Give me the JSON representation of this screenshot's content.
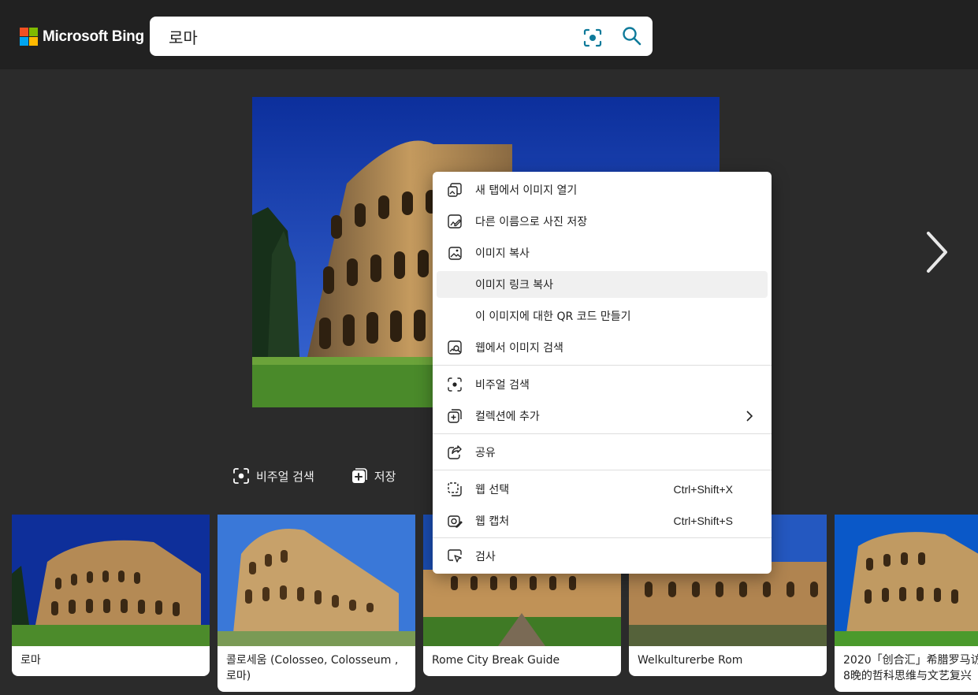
{
  "brand": {
    "name": "Microsoft Bing",
    "colors": [
      "#f25022",
      "#7fba00",
      "#00a4ef",
      "#ffb900"
    ]
  },
  "search": {
    "value": "로마",
    "visual_search_icon": "visual-search-icon",
    "search_icon": "magnifier-icon",
    "accent": "#0e7a9a"
  },
  "viewer": {
    "actions": [
      {
        "label": "비주얼 검색",
        "icon": "visual-search-icon"
      },
      {
        "label": "저장",
        "icon": "add-collection-icon"
      }
    ],
    "next_icon": "chevron-right-icon"
  },
  "context_menu": {
    "items": [
      {
        "label": "새 탭에서 이미지 열기",
        "icon": "open-image-new-tab-icon"
      },
      {
        "label": "다른 이름으로 사진 저장",
        "icon": "save-image-as-icon"
      },
      {
        "label": "이미지 복사",
        "icon": "copy-image-icon"
      },
      {
        "label": "이미지 링크 복사",
        "icon": ""
      },
      {
        "label": "이 이미지에 대한 QR 코드 만들기",
        "icon": ""
      },
      {
        "label": "웹에서 이미지 검색",
        "icon": "search-image-web-icon"
      },
      {
        "label": "비주얼 검색",
        "icon": "visual-search-icon"
      },
      {
        "label": "컬렉션에 추가",
        "icon": "add-to-collections-icon",
        "submenu": true
      },
      {
        "label": "공유",
        "icon": "share-icon"
      },
      {
        "label": "웹 선택",
        "icon": "web-select-icon",
        "shortcut": "Ctrl+Shift+X"
      },
      {
        "label": "웹 캡처",
        "icon": "web-capture-icon",
        "shortcut": "Ctrl+Shift+S"
      },
      {
        "label": "검사",
        "icon": "inspect-icon"
      }
    ],
    "hovered_index": 3
  },
  "thumbnails": [
    {
      "caption": "로마"
    },
    {
      "caption": "콜로세움 (Colosseo, Colosseum , 로마)"
    },
    {
      "caption": "Rome City Break Guide"
    },
    {
      "caption": "Welkulturerbe Rom"
    },
    {
      "caption": "2020「创合汇」希腊罗马访8晚的哲科思维与文艺复兴"
    }
  ]
}
